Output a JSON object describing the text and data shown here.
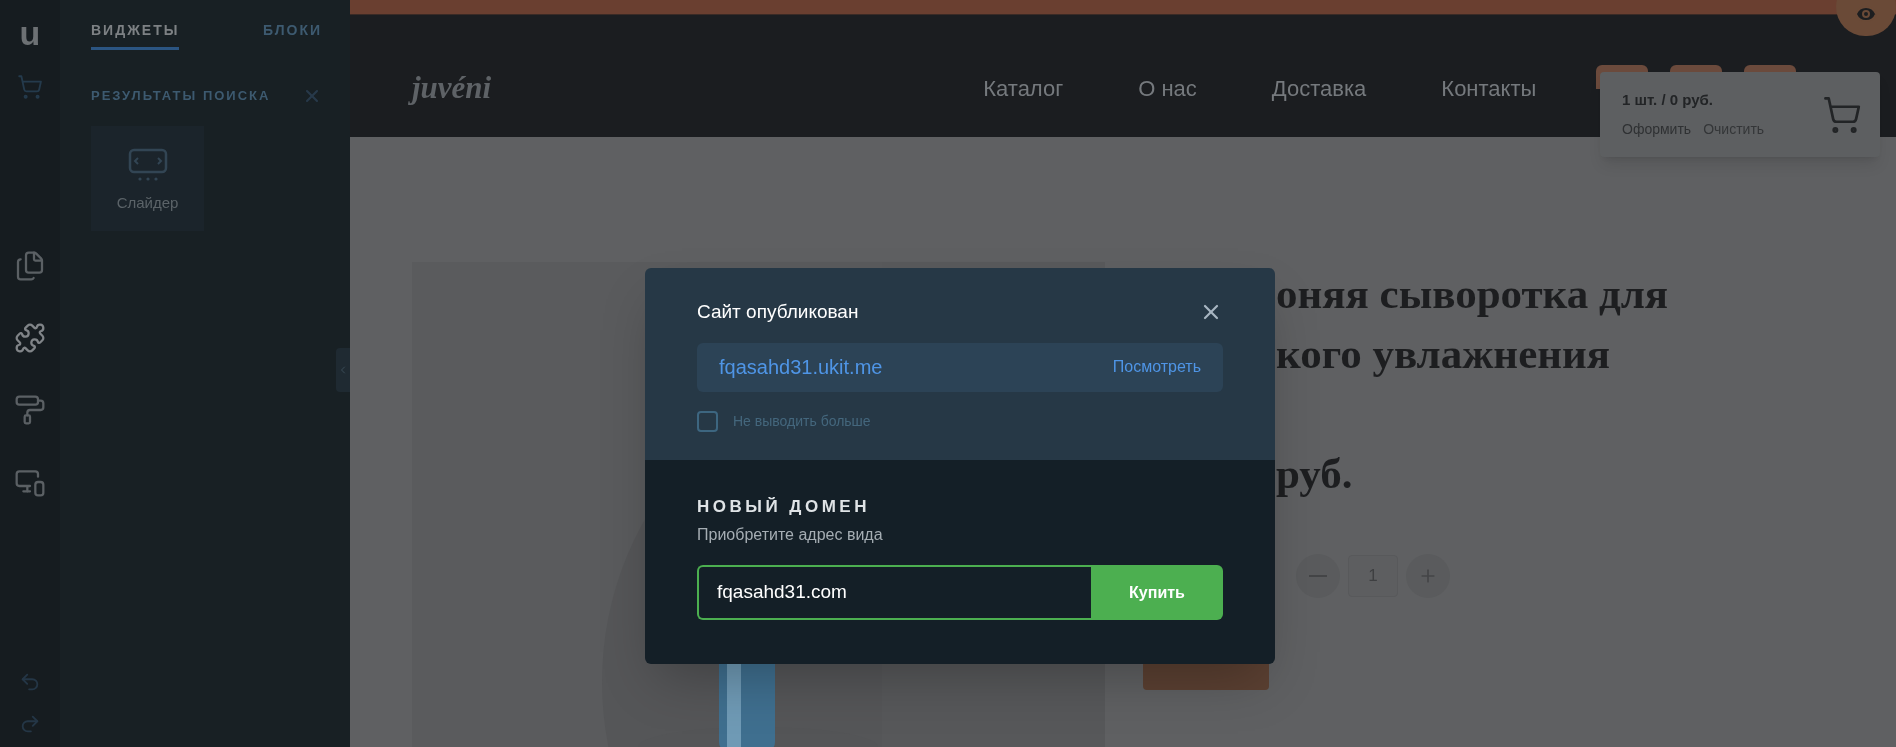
{
  "rail": {
    "logo": "u",
    "items": [
      {
        "kind": "cart",
        "selected": false
      },
      {
        "kind": "pages",
        "selected": false
      },
      {
        "kind": "widgets",
        "selected": true
      },
      {
        "kind": "design",
        "selected": false
      },
      {
        "kind": "devices",
        "selected": false
      }
    ],
    "history": [
      {
        "kind": "undo"
      },
      {
        "kind": "redo"
      }
    ]
  },
  "panel": {
    "tabs": [
      {
        "label": "ВИДЖЕТЫ",
        "selected": true
      },
      {
        "label": "БЛОКИ",
        "selected": false
      }
    ],
    "section_title": "РЕЗУЛЬТАТЫ ПОИСКА",
    "results": [
      {
        "label": "Слайдер"
      }
    ]
  },
  "site": {
    "logo": "juvéni",
    "nav": [
      "Каталог",
      "О нас",
      "Доставка",
      "Контакты"
    ],
    "cart": {
      "summary": "1 шт. / 0 руб.",
      "actions": [
        "Оформить",
        "Очистить"
      ]
    },
    "product": {
      "title_lines": [
        "оняя сыворотка для",
        "кого увлажнения"
      ],
      "price": "руб.",
      "quantity": "1"
    }
  },
  "dialog": {
    "title": "Сайт опубликован",
    "url": "fqasahd31.ukit.me",
    "view_link": "Посмотреть",
    "dont_show_again": {
      "label": "Не выводить больше",
      "checked": false
    },
    "domain": {
      "title": "НОВЫЙ ДОМЕН",
      "subtitle": "Приобретите адрес вида",
      "value": "fqasahd31.com",
      "button": "Купить"
    }
  }
}
